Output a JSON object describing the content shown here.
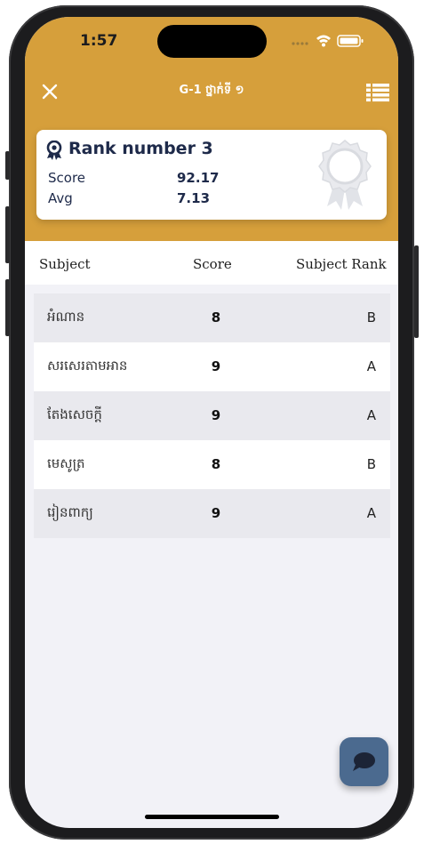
{
  "status_bar": {
    "time": "1:57"
  },
  "nav": {
    "close_icon": "close-icon",
    "title": "G-1  ថ្នាក់ទី ១",
    "menu_icon": "list-icon"
  },
  "rank_card": {
    "title": "Rank number 3",
    "score_label": "Score",
    "score_value": "92.17",
    "avg_label": "Avg",
    "avg_value": "7.13",
    "icon": "award-icon",
    "badge_icon": "medal-icon"
  },
  "table": {
    "headers": {
      "subject": "Subject",
      "score": "Score",
      "rank": "Subject Rank"
    },
    "rows": [
      {
        "subject": "អំណាន",
        "score": "8",
        "rank": "B"
      },
      {
        "subject": "សរសេរតាមអាន",
        "score": "9",
        "rank": "A"
      },
      {
        "subject": "តែងសេចក្តី",
        "score": "9",
        "rank": "A"
      },
      {
        "subject": "មេសូត្រ",
        "score": "8",
        "rank": "B"
      },
      {
        "subject": "រៀនពាក្យ",
        "score": "9",
        "rank": "A"
      }
    ]
  },
  "fab": {
    "icon": "chat-icon"
  },
  "colors": {
    "header": "#d69f3b",
    "text_dark": "#1e2a4a",
    "fab": "#4b6a8f",
    "row_shade": "#e9e9ee"
  }
}
